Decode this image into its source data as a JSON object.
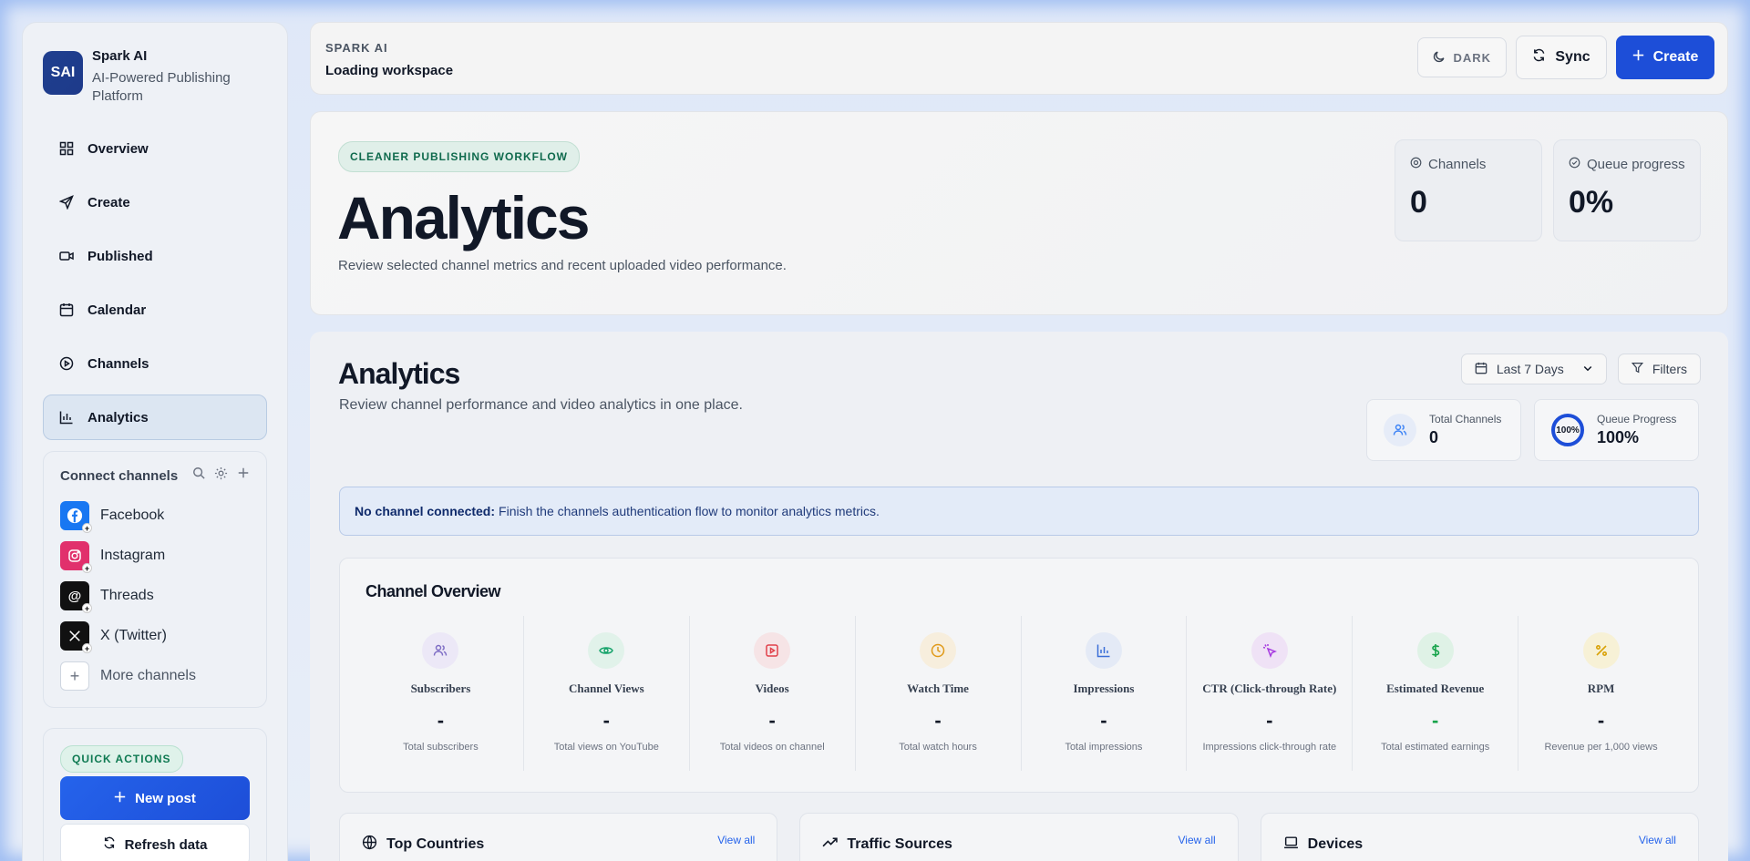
{
  "brand": {
    "logo": "SAI",
    "name": "Spark AI",
    "subtitle": "AI-Powered Publishing Platform"
  },
  "sidebar": {
    "nav": [
      {
        "label": "Overview",
        "icon": "grid-icon"
      },
      {
        "label": "Create",
        "icon": "send-icon"
      },
      {
        "label": "Published",
        "icon": "video-icon"
      },
      {
        "label": "Calendar",
        "icon": "calendar-icon"
      },
      {
        "label": "Channels",
        "icon": "play-circle-icon"
      },
      {
        "label": "Analytics",
        "icon": "bar-chart-icon",
        "active": true
      }
    ],
    "connect": {
      "title": "Connect channels",
      "channels": [
        {
          "label": "Facebook",
          "color": "#1877f2"
        },
        {
          "label": "Instagram",
          "color": "#e1306c"
        },
        {
          "label": "Threads",
          "color": "#111111"
        },
        {
          "label": "X (Twitter)",
          "color": "#111111"
        }
      ],
      "more_label": "More channels"
    },
    "quick_actions": {
      "badge": "QUICK ACTIONS",
      "new_post": "New post",
      "refresh": "Refresh data"
    }
  },
  "topbar": {
    "kicker": "SPARK AI",
    "title": "Loading workspace",
    "dark_label": "DARK",
    "sync_label": "Sync",
    "create_label": "Create"
  },
  "hero": {
    "badge": "CLEANER PUBLISHING WORKFLOW",
    "title": "Analytics",
    "subtitle": "Review selected channel metrics and recent uploaded video performance.",
    "stats": [
      {
        "label": "Channels",
        "value": "0"
      },
      {
        "label": "Queue progress",
        "value": "0%"
      }
    ]
  },
  "analytics": {
    "title": "Analytics",
    "subtitle": "Review channel performance and video analytics in one place.",
    "date_range": "Last 7 Days",
    "filters_label": "Filters",
    "total_channels": {
      "label": "Total Channels",
      "value": "0"
    },
    "queue_progress": {
      "label": "Queue Progress",
      "value": "100%",
      "ring": "100%"
    },
    "notice": {
      "strong": "No channel connected:",
      "text": "Finish the channels authentication flow to monitor analytics metrics."
    },
    "overview_title": "Channel Overview",
    "metrics": [
      {
        "name": "Subscribers",
        "value": "-",
        "desc": "Total subscribers",
        "icon": "users-icon",
        "bg": "#ece8f7",
        "fg": "#7c6bc4"
      },
      {
        "name": "Channel Views",
        "value": "-",
        "desc": "Total views on YouTube",
        "icon": "eye-icon",
        "bg": "#e1f2ea",
        "fg": "#16a36a"
      },
      {
        "name": "Videos",
        "value": "-",
        "desc": "Total videos on channel",
        "icon": "video-play-icon",
        "bg": "#f6e4e6",
        "fg": "#e0404a"
      },
      {
        "name": "Watch Time",
        "value": "-",
        "desc": "Total watch hours",
        "icon": "clock-icon",
        "bg": "#f7eedd",
        "fg": "#e09a1a"
      },
      {
        "name": "Impressions",
        "value": "-",
        "desc": "Total impressions",
        "icon": "bar-chart-icon",
        "bg": "#e4eaf6",
        "fg": "#3b6fd8"
      },
      {
        "name": "CTR (Click-through Rate)",
        "value": "-",
        "desc": "Impressions click-through rate",
        "icon": "cursor-click-icon",
        "bg": "#efe2f6",
        "fg": "#a73be0"
      },
      {
        "name": "Estimated Revenue",
        "value": "-",
        "desc": "Total estimated earnings",
        "icon": "dollar-icon",
        "bg": "#dff2e6",
        "fg": "#16a34a",
        "value_color": "#16a34a"
      },
      {
        "name": "RPM",
        "value": "-",
        "desc": "Revenue per 1,000 views",
        "icon": "percent-icon",
        "bg": "#f7f1d6",
        "fg": "#d9a208"
      }
    ],
    "bottom_cards": [
      {
        "title": "Top Countries",
        "icon": "globe-icon",
        "link": "View all"
      },
      {
        "title": "Traffic Sources",
        "icon": "trending-up-icon",
        "link": "View all"
      },
      {
        "title": "Devices",
        "icon": "laptop-icon",
        "link": "View all"
      }
    ]
  }
}
